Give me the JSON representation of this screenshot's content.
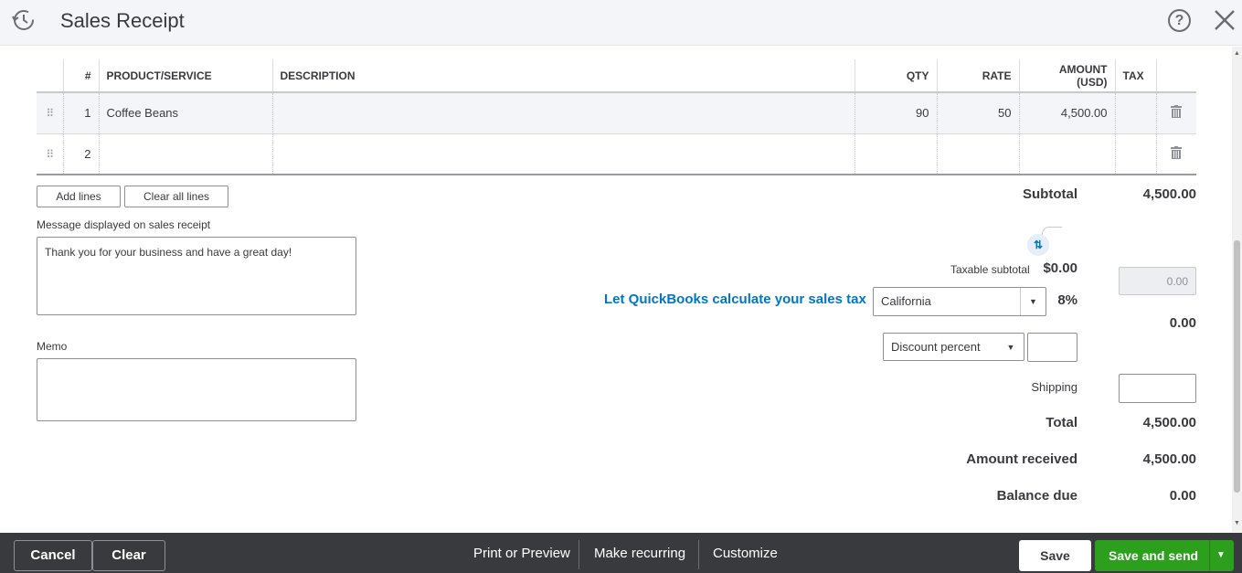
{
  "header": {
    "title": "Sales Receipt",
    "history_icon": "history-clock-icon",
    "help_icon": "help-question-icon",
    "close_icon": "close-x-icon"
  },
  "table": {
    "columns": [
      "#",
      "PRODUCT/SERVICE",
      "DESCRIPTION",
      "QTY",
      "RATE",
      "AMOUNT (USD)",
      "TAX"
    ],
    "rows": [
      {
        "num": "1",
        "product": "Coffee Beans",
        "description": "",
        "qty": "90",
        "rate": "50",
        "amount": "4,500.00",
        "tax": ""
      },
      {
        "num": "2",
        "product": "",
        "description": "",
        "qty": "",
        "rate": "",
        "amount": "",
        "tax": ""
      }
    ]
  },
  "buttons": {
    "add_lines": "Add lines",
    "clear_all_lines": "Clear all lines"
  },
  "message": {
    "label": "Message displayed on sales receipt",
    "value": "Thank you for your business and have a great day!"
  },
  "memo": {
    "label": "Memo",
    "value": ""
  },
  "totals": {
    "subtotal_label": "Subtotal",
    "subtotal_value": "4,500.00",
    "taxable_subtotal_label": "Taxable subtotal",
    "taxable_subtotal_value": "$0.00",
    "calc_tax_link": "Let QuickBooks calculate your sales tax",
    "tax_region": "California",
    "tax_rate": "8%",
    "tax_amount": "0.00",
    "tax_value": "0.00",
    "discount_type": "Discount percent",
    "discount_value": "",
    "shipping_label": "Shipping",
    "shipping_value": "",
    "total_label": "Total",
    "total_value": "4,500.00",
    "amount_received_label": "Amount received",
    "amount_received_value": "4,500.00",
    "balance_due_label": "Balance due",
    "balance_due_value": "0.00"
  },
  "footer": {
    "cancel": "Cancel",
    "clear": "Clear",
    "print_preview": "Print or Preview",
    "make_recurring": "Make recurring",
    "customize": "Customize",
    "save": "Save",
    "save_and_send": "Save and send"
  },
  "colors": {
    "accent_link": "#0077c5",
    "primary_green": "#2ca01c",
    "footer_bg": "#393a3d"
  }
}
